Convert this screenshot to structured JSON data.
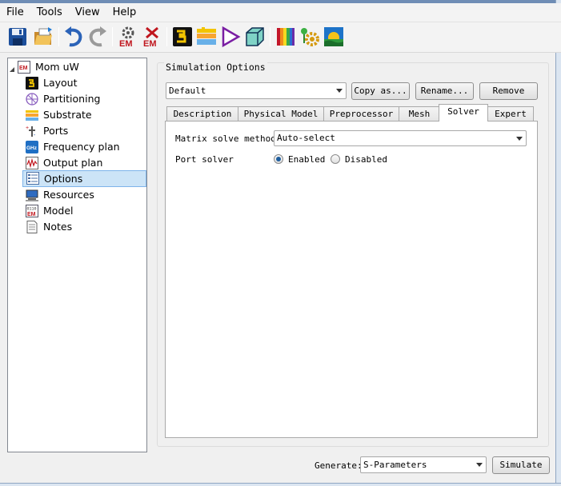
{
  "menu": [
    "File",
    "Tools",
    "View",
    "Help"
  ],
  "toolbar": {
    "icons": [
      "save-icon",
      "open-icon",
      "undo-icon",
      "redo-icon",
      "em-settings-icon",
      "em-clear-icon",
      "layout-tool-icon",
      "substrate-tool-icon",
      "port-tool-icon",
      "box-3d-icon",
      "spectrum-icon",
      "gear-plant-icon",
      "sunrise-icon"
    ],
    "em_label": "EM"
  },
  "tree": {
    "root": {
      "label": "Mom uW",
      "icon": "em-project-icon"
    },
    "items": [
      {
        "label": "Layout",
        "icon": "layout-icon"
      },
      {
        "label": "Partitioning",
        "icon": "partitioning-icon"
      },
      {
        "label": "Substrate",
        "icon": "substrate-icon"
      },
      {
        "label": "Ports",
        "icon": "ports-icon"
      },
      {
        "label": "Frequency plan",
        "icon": "ghz-icon",
        "badge": "GHz"
      },
      {
        "label": "Output plan",
        "icon": "output-plan-icon"
      },
      {
        "label": "Options",
        "icon": "options-icon",
        "selected": true
      },
      {
        "label": "Resources",
        "icon": "resources-icon"
      },
      {
        "label": "Model",
        "icon": "model-icon"
      },
      {
        "label": "Notes",
        "icon": "notes-icon"
      }
    ]
  },
  "simulation": {
    "group_title": "Simulation Options",
    "profile": "Default",
    "copy_label": "Copy as...",
    "rename_label": "Rename...",
    "remove_label": "Remove",
    "tabs": [
      "Description",
      "Physical Model",
      "Preprocessor",
      "Mesh",
      "Solver",
      "Expert"
    ],
    "active_tab": "Solver",
    "matrix_label": "Matrix solve method",
    "matrix_value": "Auto-select",
    "port_label": "Port solver",
    "port_enabled": "Enabled",
    "port_disabled": "Disabled",
    "port_value": "Enabled"
  },
  "footer": {
    "generate_label": "Generate:",
    "generate_value": "S-Parameters",
    "simulate_label": "Simulate"
  }
}
